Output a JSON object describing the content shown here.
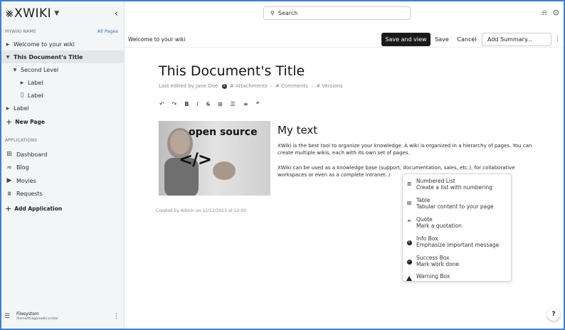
{
  "sidebar": {
    "logo": "XWIKI",
    "section_label": "MYWIKI NAME",
    "all_pages": "All Pages",
    "tree": [
      {
        "label": "Welcome to your wiki"
      },
      {
        "label": "This Document's Title"
      },
      {
        "label": "Second Level"
      },
      {
        "label": "Label"
      },
      {
        "label": "Label"
      },
      {
        "label": "Label"
      }
    ],
    "new_page": "New Page",
    "apps_label": "APPLICATIONS",
    "apps": [
      {
        "label": "Dashboard",
        "icon": "table-icon"
      },
      {
        "label": "Blog",
        "icon": "rss-icon"
      },
      {
        "label": "Movies",
        "icon": "play-icon"
      },
      {
        "label": "Requests",
        "icon": "sliders-icon"
      }
    ],
    "add_application": "Add Application",
    "storage": {
      "name": "Filesystem",
      "path": "/home/thiago/xwiki-cristal"
    }
  },
  "topbar": {
    "search_placeholder": "Search"
  },
  "toolbar": {
    "breadcrumb": "Welcome to your wiki",
    "save_and_view": "Save and view",
    "save": "Save",
    "cancel": "Cancel",
    "summary_placeholder": "Add Summary..."
  },
  "document": {
    "title": "This Document's Title",
    "meta": {
      "edited": "Last edited by Jane Doe",
      "attachments": "# Attachments",
      "comments": "# Comments",
      "versions": "# Versions"
    },
    "image": {
      "caption_top": "open source",
      "caption_code": "</>"
    },
    "created": "Created by Admin on 12/12/2023 at 12:00",
    "heading": "My text",
    "paragraph1": "XWiki is the best tool to organize your knowledge. A wiki is organized in a hierarchy of pages. You can create multiple wikis, each with its own set of pages.",
    "paragraph2": "XWiki can be used as a knowledge base (support, documentation, sales, etc.), for collaborative workspaces or even as a complete intranet. /"
  },
  "slash_menu": [
    {
      "title": "Numbered List",
      "desc": "Create a list with numbering",
      "icon": "numbered-list-icon"
    },
    {
      "title": "Table",
      "desc": "Tabular content to your page",
      "icon": "table-icon"
    },
    {
      "title": "Quote",
      "desc": "Mark a quotation",
      "icon": "quote-icon"
    },
    {
      "title": "Info Box",
      "desc": "Emphasize important message",
      "icon": "info-icon"
    },
    {
      "title": "Success Box",
      "desc": "Mark work done",
      "icon": "check-circle-icon"
    },
    {
      "title": "Warning Box",
      "desc": "",
      "icon": "warning-icon"
    }
  ],
  "help": "?",
  "colors": {
    "accent": "#3a82d6",
    "primary_button": "#1a1a1a",
    "sidebar_bg": "#f4f5f7"
  }
}
